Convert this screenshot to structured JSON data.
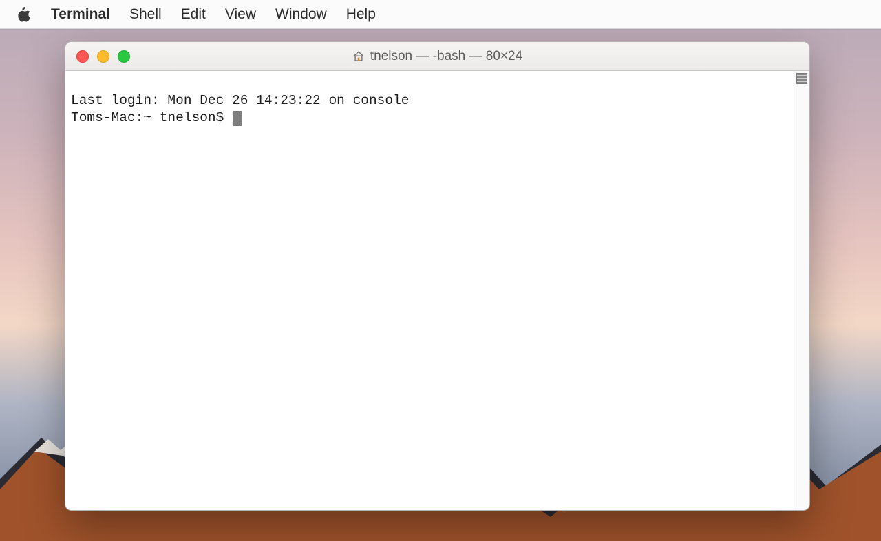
{
  "menu_bar": {
    "apple_icon": "apple-logo",
    "app_name": "Terminal",
    "items": [
      "Shell",
      "Edit",
      "View",
      "Window",
      "Help"
    ]
  },
  "window": {
    "title": "tnelson — -bash — 80×24",
    "title_icon": "home-icon",
    "traffic_lights": {
      "close": "close",
      "minimize": "minimize",
      "zoom": "zoom"
    }
  },
  "terminal": {
    "last_login_line": "Last login: Mon Dec 26 14:23:22 on console",
    "prompt": "Toms-Mac:~ tnelson$ "
  }
}
